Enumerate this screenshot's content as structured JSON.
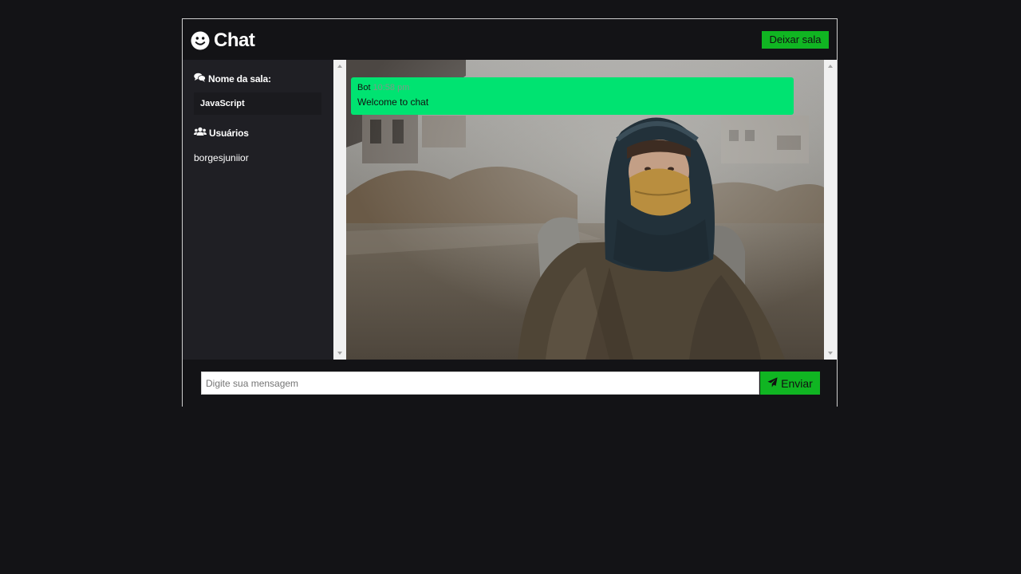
{
  "header": {
    "logo_icon": "smile-icon",
    "title": "Chat",
    "leave_button": "Deixar sala"
  },
  "sidebar": {
    "room_heading_icon": "comments-icon",
    "room_heading": "Nome da sala:",
    "room_name": "JavaScript",
    "users_heading_icon": "users-icon",
    "users_heading": "Usuários",
    "users": [
      "borgesjuniior"
    ]
  },
  "chat": {
    "background_image": "hooded-figure-photo",
    "messages": [
      {
        "author": "Bot",
        "time": "10:58 pm",
        "text": "Welcome to chat"
      }
    ]
  },
  "composer": {
    "placeholder": "Digite sua mensagem",
    "value": "",
    "send_icon": "paper-plane-icon",
    "send_label": "Enviar"
  },
  "colors": {
    "background": "#131316",
    "sidebar": "#1f1f24",
    "accent": "#10b522",
    "message_bubble": "#00e371"
  }
}
